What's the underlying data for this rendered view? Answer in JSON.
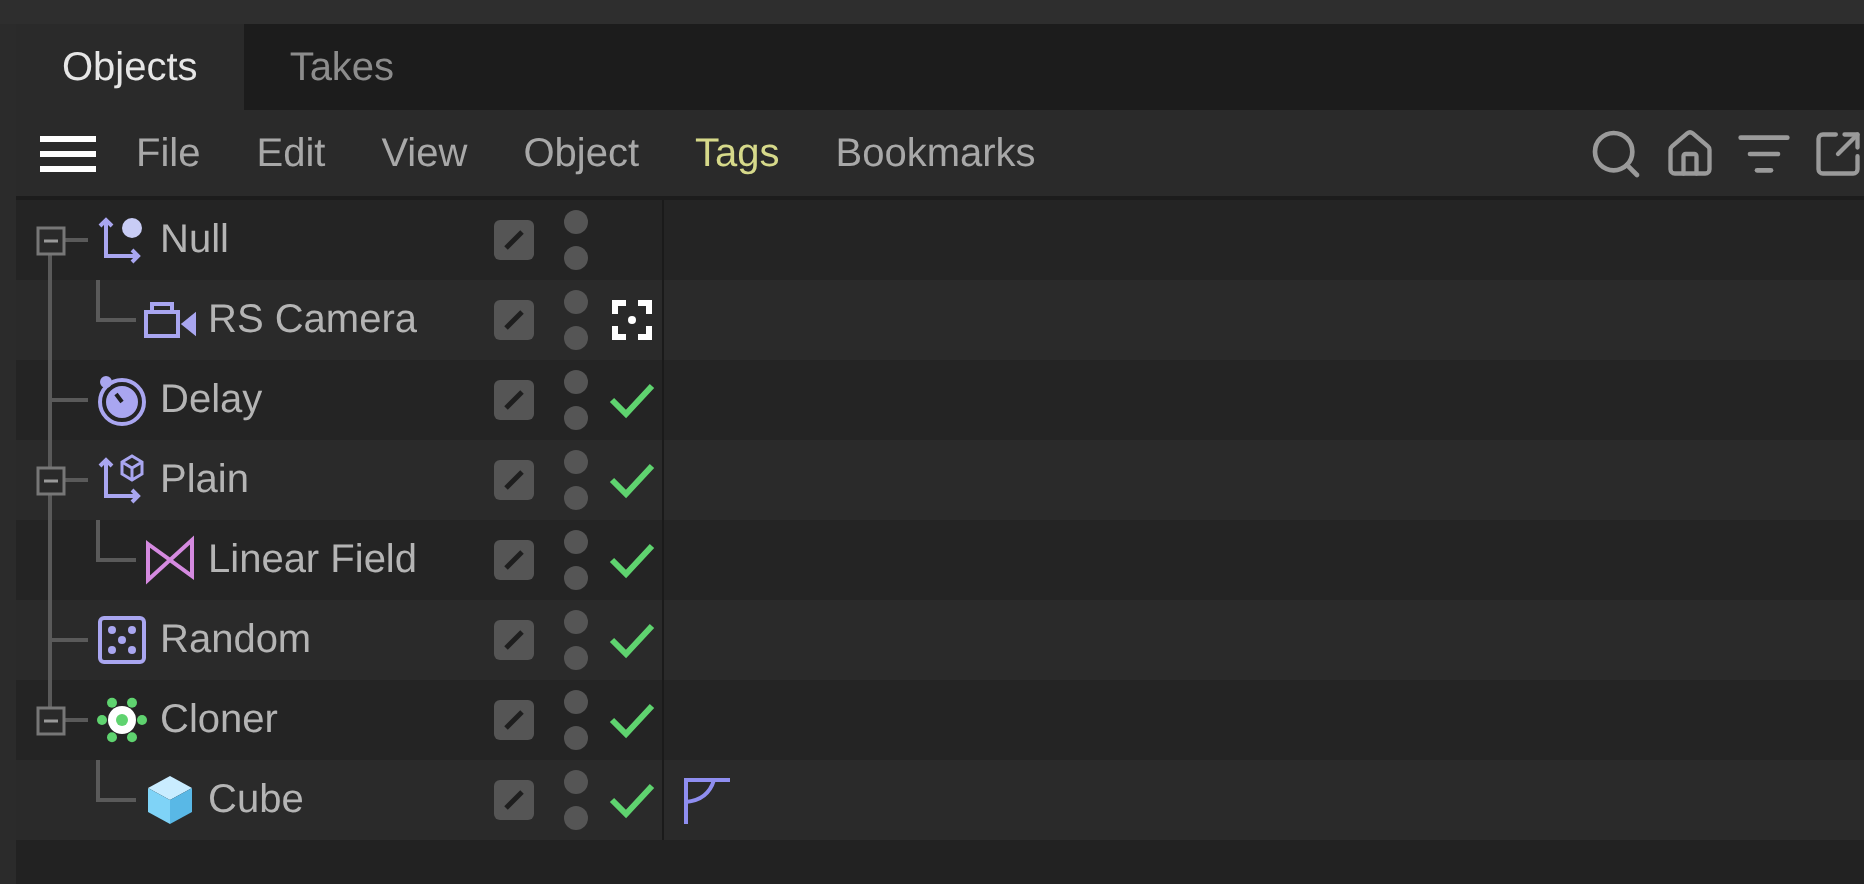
{
  "tabs": [
    {
      "label": "Objects",
      "selected": true
    },
    {
      "label": "Takes",
      "selected": false
    }
  ],
  "menu": [
    {
      "label": "File",
      "highlighted": false
    },
    {
      "label": "Edit",
      "highlighted": false
    },
    {
      "label": "View",
      "highlighted": false
    },
    {
      "label": "Object",
      "highlighted": false
    },
    {
      "label": "Tags",
      "highlighted": true
    },
    {
      "label": "Bookmarks",
      "highlighted": false
    }
  ],
  "objects": [
    {
      "name": "Null",
      "kind": "null",
      "expanded": true,
      "children": [
        {
          "name": "RS Camera",
          "kind": "camera",
          "status": {
            "kind": "target"
          }
        }
      ]
    },
    {
      "name": "Delay",
      "kind": "delay",
      "status": {
        "kind": "check"
      }
    },
    {
      "name": "Plain",
      "kind": "plain",
      "status": {
        "kind": "check"
      },
      "expanded": true,
      "children": [
        {
          "name": "Linear Field",
          "kind": "field",
          "status": {
            "kind": "check"
          }
        }
      ]
    },
    {
      "name": "Random",
      "kind": "random",
      "status": {
        "kind": "check"
      }
    },
    {
      "name": "Cloner",
      "kind": "cloner",
      "status": {
        "kind": "check"
      },
      "expanded": true,
      "children": [
        {
          "name": "Cube",
          "kind": "cube",
          "status": {
            "kind": "check"
          },
          "tags": [
            {
              "kind": "phong"
            }
          ]
        }
      ]
    }
  ]
}
